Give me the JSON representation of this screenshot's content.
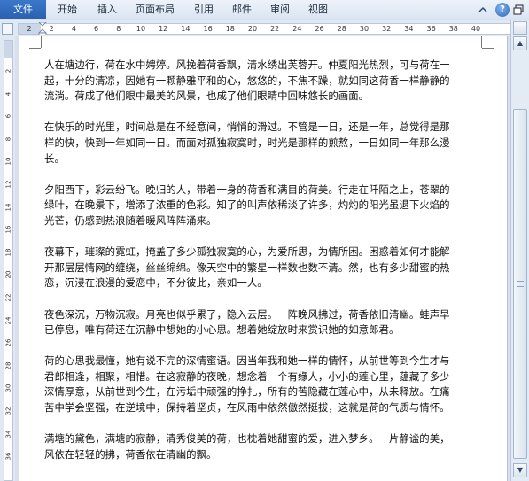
{
  "ribbon": {
    "file_tab": "文件",
    "tabs": [
      "开始",
      "插入",
      "页面布局",
      "引用",
      "邮件",
      "审阅",
      "视图"
    ]
  },
  "icons": {
    "collapse": "collapse-ribbon-icon",
    "help": "help-icon",
    "restore": "restore-window-icon",
    "scroll_up": "scroll-up-arrow-icon",
    "scroll_down": "scroll-down-arrow-icon"
  },
  "ruler": {
    "labels": [
      "2",
      "2",
      "4",
      "6",
      "8",
      "10",
      "12",
      "14",
      "16",
      "18",
      "20",
      "22",
      "24",
      "26",
      "28",
      "30",
      "32",
      "34",
      "36",
      "38",
      "40"
    ]
  },
  "vruler": {
    "labels": [
      "2",
      "4",
      "6",
      "8",
      "10",
      "12",
      "14",
      "16",
      "18",
      "20",
      "22",
      "24",
      "26",
      "28",
      "30",
      "32",
      "34",
      "36",
      "38"
    ]
  },
  "document": {
    "paragraphs": [
      {
        "lines": [
          "人在塘边行，荷在水中娉婷。风挽着荷香飘，清水绣出芙蓉开。仲夏阳光热烈，可与荷在一",
          "起，十分的清凉，因她有一颗静雅平和的心，悠悠的，不焦不躁，就如同这荷香一样静静的",
          "流淌。荷成了他们眼中最美的风景，也成了他们眼睛中回味悠长的画面。"
        ]
      },
      {
        "lines": [
          "在快乐的时光里，时间总是在不经意间，悄悄的滑过。不管是一日，还是一年，总觉得是那",
          "样的快，快到一年如同一日。而面对孤独寂寞时，时光是那样的煎熬，一日如同一年那么漫",
          "长。"
        ]
      },
      {
        "lines": [
          "夕阳西下，彩云纷飞。晚归的人，带着一身的荷香和满目的荷美。行走在阡陌之上，苍翠的",
          "绿叶，在晚景下，增添了浓重的色彩。知了的叫声依稀淡了许多，灼灼的阳光虽退下火焰的",
          "光芒，仍感到热浪随着暖风阵阵涌来。"
        ]
      },
      {
        "lines": [
          "夜幕下，璀璨的霓虹，掩盖了多少孤独寂寞的心，为爱所思，为情所困。困惑着如何才能解",
          "开那层层情网的缠绕，丝丝绵绵。像天空中的繁星一样数也数不清。然，也有多少甜蜜的热",
          "恋，沉浸在浪漫的爱恋中，不分彼此，亲如一人。"
        ]
      },
      {
        "lines": [
          "夜色深沉，万物沉寂。月亮也似乎累了，隐入云层。一阵晚风拂过，荷香依旧清幽。蛙声早",
          "已停息，唯有荷还在沉静中想她的小心思。想着她绽放时来赏识她的如意郎君。"
        ]
      },
      {
        "lines": [
          "荷的心思我最懂，她有说不完的深情蜜语。因当年我和她一样的情怀，从前世等到今生才与",
          "君郎相逢，相聚，相惜。在这寂静的夜晚，想念着一个有缘人，小小的莲心里，蕴藏了多少",
          "深情厚意，从前世到今生，在污垢中顽强的挣扎，所有的苦隐藏在莲心中，从未释放。在痛",
          "苦中学会坚强，在逆境中，保持着坚贞，在风雨中依然傲然挺拔，这就是荷的气质与情怀。"
        ]
      },
      {
        "lines": [
          "满塘的黛色，满塘的寂静，清秀俊美的荷，也枕着她甜蜜的爱，进入梦乡。一片静谧的美，",
          "风依在轻轻的拂，荷香依在清幽的飘。"
        ]
      }
    ]
  }
}
